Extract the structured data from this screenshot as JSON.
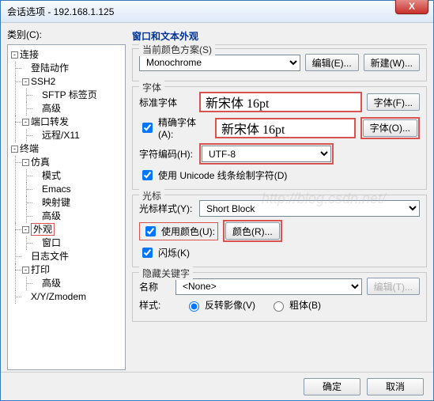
{
  "window": {
    "title": "会话选项 - 192.168.1.125",
    "close": "X"
  },
  "category_label": "类别(C):",
  "tree": {
    "connect": "连接",
    "login": "登陆动作",
    "ssh2": "SSH2",
    "sftp": "SFTP 标签页",
    "advanced": "高级",
    "portfwd": "端口转发",
    "remote": "远程/X11",
    "terminal": "终端",
    "emulation": "仿真",
    "mode": "模式",
    "emacs": "Emacs",
    "keymap": "映射键",
    "adv2": "高级",
    "appearance": "外观",
    "windownode": "窗口",
    "logfile": "日志文件",
    "print": "打印",
    "adv3": "高级",
    "xyz": "X/Y/Zmodem",
    "toggle_minus": "-",
    "toggle_plus": "-"
  },
  "right": {
    "title": "窗口和文本外观",
    "scheme": {
      "legend": "当前颜色方案(S)",
      "value": "Monochrome",
      "edit": "编辑(E)...",
      "new": "新建(W)..."
    },
    "font": {
      "legend": "字体",
      "std_label": "标准字体",
      "std_value": "新宋体  16pt",
      "std_btn": "字体(F)...",
      "precise_chk": "精确字体(A):",
      "precise_value": "新宋体  16pt",
      "precise_btn": "字体(O)...",
      "enc_label": "字符编码(H):",
      "enc_value": "UTF-8",
      "unicode_chk": "使用 Unicode 线条绘制字符(D)"
    },
    "cursor": {
      "legend": "光标",
      "style_label": "光标样式(Y):",
      "style_value": "Short Block",
      "usecolor": "使用颜色(U):",
      "color_btn": "颜色(R)...",
      "blink": "闪烁(K)"
    },
    "keyword": {
      "legend": "隐藏关键字",
      "name_label": "名称",
      "name_value": "<None>",
      "edit_btn": "编辑(T)...",
      "style_label": "样式:",
      "radio1": "反转影像(V)",
      "radio2": "粗体(B)"
    }
  },
  "footer": {
    "ok": "确定",
    "cancel": "取消"
  },
  "watermark": "http://blog.csdn.net/"
}
